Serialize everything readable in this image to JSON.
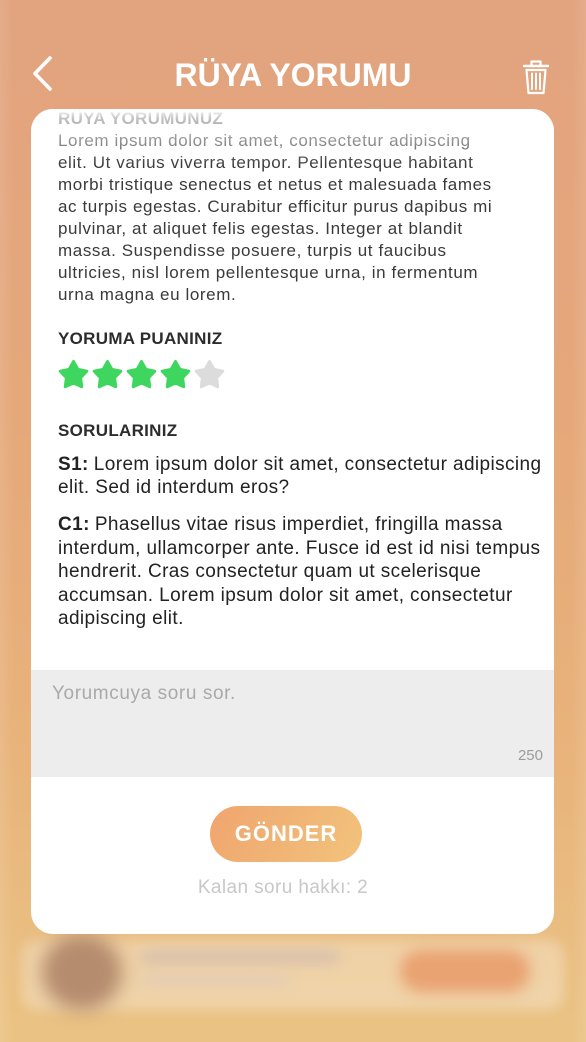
{
  "header": {
    "title": "RÜYA YORUMU",
    "back_icon": "chevron-left-icon",
    "delete_icon": "trash-icon"
  },
  "interpretation": {
    "heading": "RÜYA YORUMUNUZ",
    "lines": [
      "Lorem ipsum dolor sit amet, consectetur adipiscing",
      "elit. Ut varius viverra tempor. Pellentesque habitant",
      "morbi tristique senectus et netus et malesuada fames",
      "ac turpis egestas. Curabitur efficitur purus dapibus mi",
      "pulvinar, at aliquet felis egestas. Integer at blandit",
      "massa. Suspendisse posuere, turpis ut faucibus",
      "ultricies, nisl lorem pellentesque urna, in fermentum",
      "urna magna eu lorem."
    ]
  },
  "rating": {
    "heading": "YORUMA PUANINIZ",
    "value": 4,
    "max": 5,
    "icon": "star-icon"
  },
  "questions": {
    "heading": "SORULARINIZ",
    "items": [
      {
        "label": "S1:",
        "lines": [
          "Lorem ipsum dolor sit amet, consectetur adipiscing",
          "elit. Sed id interdum eros?"
        ]
      },
      {
        "label": "C1:",
        "lines": [
          "Phasellus vitae risus imperdiet, fringilla massa",
          "interdum, ullamcorper ante. Fusce id est id nisi tempus",
          "hendrerit. Cras consectetur quam ut scelerisque",
          "accumsan. Lorem ipsum dolor sit amet, consectetur",
          "adipiscing elit."
        ]
      }
    ]
  },
  "ask": {
    "placeholder": "Yorumcuya soru sor.",
    "value": "",
    "char_limit": "250"
  },
  "submit_label": "GÖNDER",
  "remaining_text": "Kalan soru hakkı: 2",
  "colors": {
    "background_top": "#E2A37F",
    "background_bottom": "#EAC384",
    "card": "#FFFFFF",
    "star_filled": "#3FD65F",
    "star_empty": "#DCDCDC",
    "button_start": "#EFA56E",
    "button_end": "#F2C37C",
    "input_background": "#EDEDED",
    "muted_text": "#C8C8C8"
  }
}
